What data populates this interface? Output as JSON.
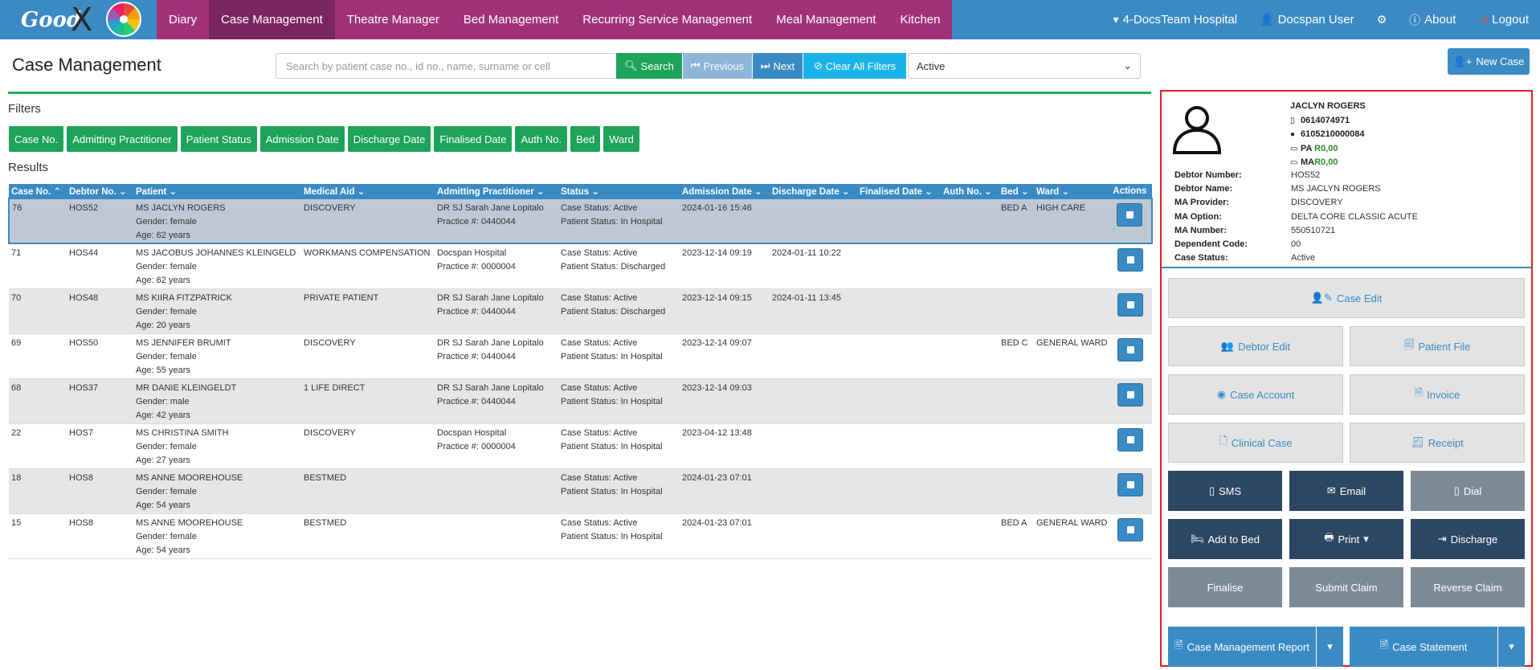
{
  "nav": {
    "logo_text": "Good",
    "logo_x": "X",
    "items": [
      "Diary",
      "Case Management",
      "Theatre Manager",
      "Bed Management",
      "Recurring Service Management",
      "Meal Management",
      "Kitchen"
    ],
    "hospital": "4-DocsTeam Hospital",
    "user": "Docspan User",
    "about": "About",
    "logout": "Logout"
  },
  "toolbar": {
    "title": "Case Management",
    "search_placeholder": "Search by patient case no., id no., name, surname or cell",
    "search": "Search",
    "previous": "Previous",
    "next": "Next",
    "clear_filters": "Clear All Filters",
    "status_value": "Active",
    "new_case": "New Case"
  },
  "filters": {
    "label": "Filters",
    "buttons": [
      "Case No.",
      "Admitting Practitioner",
      "Patient Status",
      "Admission Date",
      "Discharge Date",
      "Finalised Date",
      "Auth No.",
      "Bed",
      "Ward"
    ]
  },
  "results": {
    "label": "Results",
    "columns": [
      "Case No.",
      "Debtor No.",
      "Patient",
      "Medical Aid",
      "Admitting Practitioner",
      "Status",
      "Admission Date",
      "Discharge Date",
      "Finalised Date",
      "Auth No.",
      "Bed",
      "Ward",
      "Actions"
    ],
    "rows": [
      {
        "case": "76",
        "debtor": "HOS52",
        "patient": "MS JACLYN ROGERS",
        "gender": "Gender: female",
        "age": "Age: 62 years",
        "aid": "DISCOVERY",
        "prac": "DR SJ Sarah Jane Lopitalo",
        "practice": "Practice #: 0440044",
        "cstatus": "Case Status: Active",
        "pstatus": "Patient Status: In Hospital",
        "adm": "2024-01-16 15:46",
        "dis": "",
        "fin": "",
        "auth": "",
        "bed": "BED A",
        "ward": "HIGH CARE"
      },
      {
        "case": "71",
        "debtor": "HOS44",
        "patient": "MS JACOBUS JOHANNES KLEINGELD",
        "gender": "Gender: female",
        "age": "Age: 62 years",
        "aid": "WORKMANS COMPENSATION",
        "prac": "Docspan Hospital",
        "practice": "Practice #: 0000004",
        "cstatus": "Case Status: Active",
        "pstatus": "Patient Status: Discharged",
        "adm": "2023-12-14 09:19",
        "dis": "2024-01-11 10:22",
        "fin": "",
        "auth": "",
        "bed": "",
        "ward": ""
      },
      {
        "case": "70",
        "debtor": "HOS48",
        "patient": "MS KIIRA FITZPATRICK",
        "gender": "Gender: female",
        "age": "Age: 20 years",
        "aid": "PRIVATE PATIENT",
        "prac": "DR SJ Sarah Jane Lopitalo",
        "practice": "Practice #: 0440044",
        "cstatus": "Case Status: Active",
        "pstatus": "Patient Status: Discharged",
        "adm": "2023-12-14 09:15",
        "dis": "2024-01-11 13:45",
        "fin": "",
        "auth": "",
        "bed": "",
        "ward": ""
      },
      {
        "case": "69",
        "debtor": "HOS50",
        "patient": "MS JENNIFER BRUMIT",
        "gender": "Gender: female",
        "age": "Age: 55 years",
        "aid": "DISCOVERY",
        "prac": "DR SJ Sarah Jane Lopitalo",
        "practice": "Practice #: 0440044",
        "cstatus": "Case Status: Active",
        "pstatus": "Patient Status: In Hospital",
        "adm": "2023-12-14 09:07",
        "dis": "",
        "fin": "",
        "auth": "",
        "bed": "BED C",
        "ward": "GENERAL WARD"
      },
      {
        "case": "68",
        "debtor": "HOS37",
        "patient": "MR DANIE KLEINGELDT",
        "gender": "Gender: male",
        "age": "Age: 42 years",
        "aid": "1 LIFE DIRECT",
        "prac": "DR SJ Sarah Jane Lopitalo",
        "practice": "Practice #: 0440044",
        "cstatus": "Case Status: Active",
        "pstatus": "Patient Status: In Hospital",
        "adm": "2023-12-14 09:03",
        "dis": "",
        "fin": "",
        "auth": "",
        "bed": "",
        "ward": ""
      },
      {
        "case": "22",
        "debtor": "HOS7",
        "patient": "MS CHRISTINA SMITH",
        "gender": "Gender: female",
        "age": "Age: 27 years",
        "aid": "DISCOVERY",
        "prac": "Docspan Hospital",
        "practice": "Practice #: 0000004",
        "cstatus": "Case Status: Active",
        "pstatus": "Patient Status: In Hospital",
        "adm": "2023-04-12 13:48",
        "dis": "",
        "fin": "",
        "auth": "",
        "bed": "",
        "ward": ""
      },
      {
        "case": "18",
        "debtor": "HOS8",
        "patient": "MS ANNE MOOREHOUSE",
        "gender": "Gender: female",
        "age": "Age: 54 years",
        "aid": "BESTMED",
        "prac": "",
        "practice": "",
        "cstatus": "Case Status: Active",
        "pstatus": "Patient Status: In Hospital",
        "adm": "2024-01-23 07:01",
        "dis": "",
        "fin": "",
        "auth": "",
        "bed": "",
        "ward": ""
      },
      {
        "case": "15",
        "debtor": "HOS8",
        "patient": "MS ANNE MOOREHOUSE",
        "gender": "Gender: female",
        "age": "Age: 54 years",
        "aid": "BESTMED",
        "prac": "",
        "practice": "",
        "cstatus": "Case Status: Active",
        "pstatus": "Patient Status: In Hospital",
        "adm": "2024-01-23 07:01",
        "dis": "",
        "fin": "",
        "auth": "",
        "bed": "BED A",
        "ward": "GENERAL WARD"
      }
    ]
  },
  "panel": {
    "name": "JACLYN ROGERS",
    "cell": "0614074971",
    "id": "6105210000084",
    "pa_label": "PA",
    "pa_value": "R0,00",
    "ma_label": "MA",
    "ma_value": "R0,00",
    "details": [
      {
        "label": "Debtor Number:",
        "value": "HOS52"
      },
      {
        "label": "Debtor Name:",
        "value": "MS JACLYN ROGERS"
      },
      {
        "label": "MA Provider:",
        "value": "DISCOVERY"
      },
      {
        "label": "MA Option:",
        "value": "DELTA CORE CLASSIC ACUTE"
      },
      {
        "label": "MA Number:",
        "value": "550510721"
      },
      {
        "label": "Dependent Code:",
        "value": "00"
      },
      {
        "label": "Case Status:",
        "value": "Active"
      }
    ],
    "buttons": {
      "case_edit": "Case Edit",
      "debtor_edit": "Debtor Edit",
      "patient_file": "Patient File",
      "case_account": "Case Account",
      "invoice": "Invoice",
      "clinical_case": "Clinical Case",
      "receipt": "Receipt",
      "sms": "SMS",
      "email": "Email",
      "dial": "Dial",
      "add_to_bed": "Add to Bed",
      "print": "Print",
      "discharge": "Discharge",
      "finalise": "Finalise",
      "submit_claim": "Submit Claim",
      "reverse_claim": "Reverse Claim",
      "case_management_report": "Case Management Report",
      "case_statement": "Case Statement"
    }
  }
}
